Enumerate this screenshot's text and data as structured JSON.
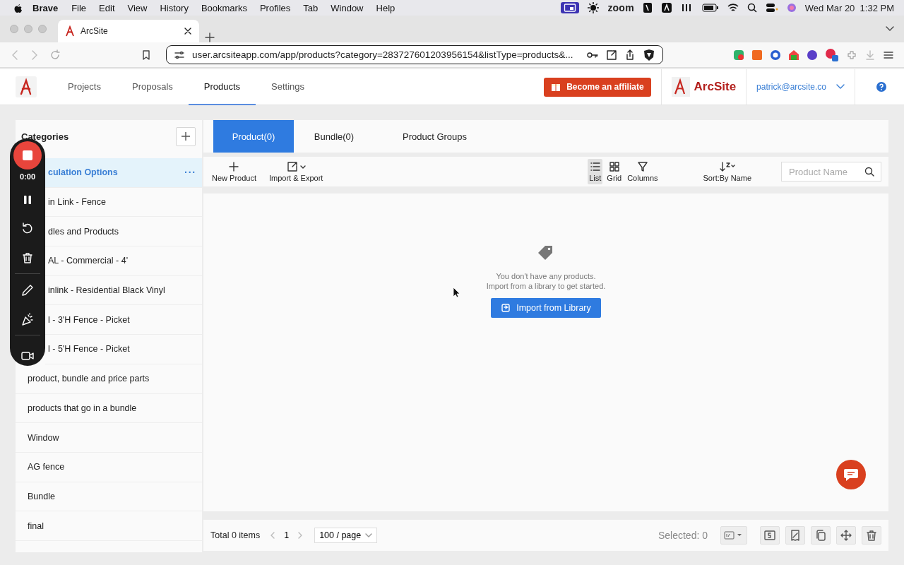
{
  "menu_bar": {
    "app": "Brave",
    "menus": [
      "File",
      "Edit",
      "View",
      "History",
      "Bookmarks",
      "Profiles",
      "Tab",
      "Window",
      "Help"
    ],
    "zoom_label": "zoom",
    "clock": "Wed Mar 20  1:32 PM"
  },
  "browser": {
    "tab_title": "ArcSite",
    "url": "user.arcsiteapp.com/app/products?category=283727601203956154&listType=products&..."
  },
  "nav": {
    "items": [
      {
        "label": "Projects",
        "selected": false
      },
      {
        "label": "Proposals",
        "selected": false
      },
      {
        "label": "Products",
        "selected": true
      },
      {
        "label": "Settings",
        "selected": false
      }
    ],
    "affiliate_button": "Become an affiliate",
    "brand": "ArcSite",
    "account": "patrick@arcsite.co"
  },
  "recorder": {
    "timer": "0:00"
  },
  "categories": {
    "title": "Categories",
    "items": [
      {
        "label": "culation Options",
        "selected": true,
        "more": "···"
      },
      {
        "label": "in Link - Fence",
        "selected": false
      },
      {
        "label": "dles and Products",
        "selected": false
      },
      {
        "label": "AL - Commercial - 4'",
        "selected": false
      },
      {
        "label": "inlink - Residential Black Vinyl",
        "selected": false
      },
      {
        "label": "l - 3'H Fence - Picket",
        "selected": false
      },
      {
        "label": "l - 5'H Fence - Picket",
        "selected": false
      },
      {
        "label": "product, bundle and price parts",
        "selected": false
      },
      {
        "label": "products that go in a bundle",
        "selected": false
      },
      {
        "label": "Window",
        "selected": false
      },
      {
        "label": "AG fence",
        "selected": false
      },
      {
        "label": "Bundle",
        "selected": false
      },
      {
        "label": "final",
        "selected": false
      }
    ]
  },
  "product_tabs": [
    {
      "label": "Product(0)",
      "selected": true
    },
    {
      "label": "Bundle(0)",
      "selected": false
    },
    {
      "label": "Product Groups",
      "selected": false
    }
  ],
  "toolbar": {
    "actions": [
      {
        "kind": "new",
        "label": "New Product"
      },
      {
        "kind": "import",
        "label": "Import & Export"
      }
    ],
    "views": [
      {
        "kind": "list",
        "label": "List",
        "selected": true
      },
      {
        "kind": "grid",
        "label": "Grid",
        "selected": false
      }
    ],
    "columns": "Columns",
    "sort": "Sort:By Name",
    "search": {
      "placeholder": "Product Name"
    }
  },
  "empty_state": {
    "message": "You don't have any products.",
    "hint": "Import from a library to get started.",
    "button": "Import from Library"
  },
  "footer": {
    "total": "Total 0 items",
    "page": "1",
    "page_size": "100 / page",
    "selected": "Selected: 0"
  }
}
